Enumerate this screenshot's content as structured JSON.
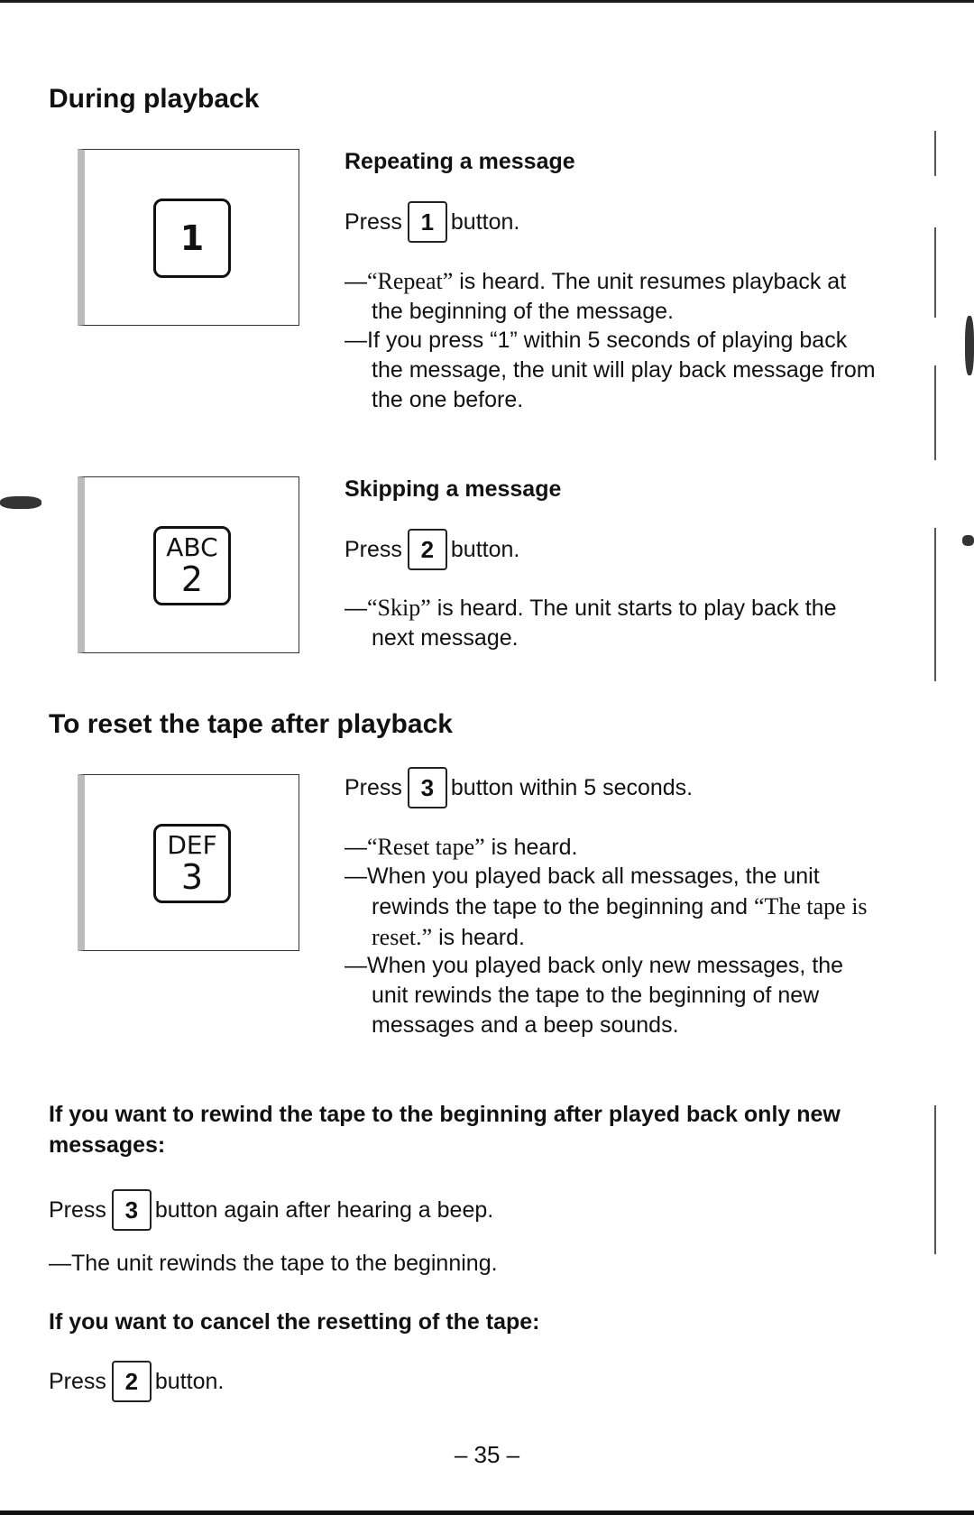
{
  "page": {
    "page_number": "– 35 –"
  },
  "sections": {
    "during_playback": {
      "title": "During playback",
      "repeat": {
        "heading": "Repeating a message",
        "illustration_key": {
          "letters": "",
          "digit": "1"
        },
        "press_prefix": "Press",
        "key": "1",
        "press_suffix": "button.",
        "bullets": [
          {
            "quote": "“Repeat”",
            "text": " is heard. The unit resumes playback at the beginning of the message."
          },
          {
            "quote": "",
            "text": "If you press “1” within 5 seconds of playing back the message, the unit will play back message from the one before."
          }
        ]
      },
      "skip": {
        "heading": "Skipping a message",
        "illustration_key": {
          "letters": "ABC",
          "digit": "2"
        },
        "press_prefix": "Press",
        "key": "2",
        "press_suffix": "button.",
        "bullets": [
          {
            "quote": "“Skip”",
            "text": " is heard. The unit starts to play back the next message."
          }
        ]
      }
    },
    "reset_tape": {
      "title": "To reset the tape after playback",
      "illustration_key": {
        "letters": "DEF",
        "digit": "3"
      },
      "press_prefix": "Press",
      "key": "3",
      "press_suffix": "button within 5 seconds.",
      "bullets": [
        {
          "quote": "“Reset tape”",
          "text": " is heard."
        },
        {
          "quote": "",
          "text": "When you played back all messages, the unit rewinds the tape to the beginning and ",
          "quote_after": "“The tape is reset.”",
          "text_after": " is heard."
        },
        {
          "quote": "",
          "text": "When you played back only new messages, the unit rewinds the tape to the beginning of new messages and a beep sounds."
        }
      ]
    },
    "rewind_beginning": {
      "heading": "If you want to rewind the tape to the beginning after played back only new messages:",
      "press_prefix": "Press",
      "key": "3",
      "press_suffix": "button again after hearing a beep.",
      "result": "—The unit rewinds the tape to the beginning."
    },
    "cancel_reset": {
      "heading": "If you want to cancel the resetting of the tape:",
      "press_prefix": "Press",
      "key": "2",
      "press_suffix": "button."
    }
  },
  "dash": "—"
}
